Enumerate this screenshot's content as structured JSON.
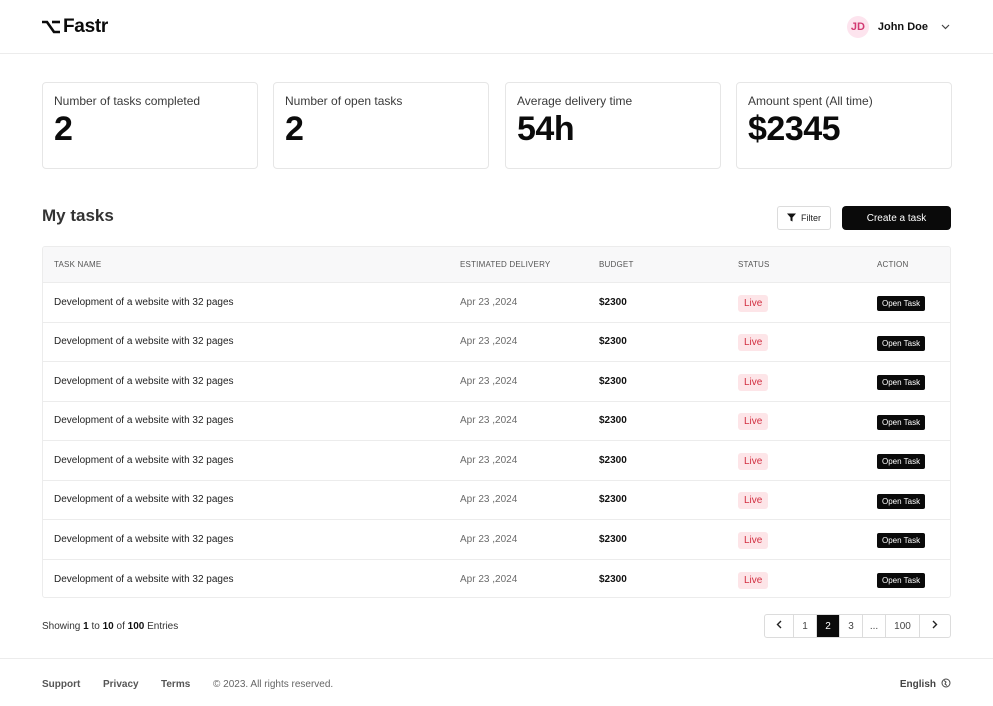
{
  "app": {
    "name": "Fastr"
  },
  "header": {
    "user": {
      "initials": "JD",
      "name": "John Doe"
    }
  },
  "stats": [
    {
      "label": "Number of tasks completed",
      "value": "2"
    },
    {
      "label": "Number of open tasks",
      "value": "2"
    },
    {
      "label": "Average delivery time",
      "value": "54h"
    },
    {
      "label": "Amount spent (All time)",
      "value": "$2345"
    }
  ],
  "tasks": {
    "title": "My tasks",
    "filter_label": "Filter",
    "create_label": "Create a task",
    "columns": [
      "TASK NAME",
      "ESTIMATED DELIVERY",
      "BUDGET",
      "STATUS",
      "ACTION"
    ],
    "rows": [
      {
        "name": "Development of a website with 32 pages",
        "delivery": "Apr 23 ,2024",
        "budget": "$2300",
        "status": "Live",
        "action": "Open Task"
      },
      {
        "name": "Development of a website with 32 pages",
        "delivery": "Apr 23 ,2024",
        "budget": "$2300",
        "status": "Live",
        "action": "Open Task"
      },
      {
        "name": "Development of a website with 32 pages",
        "delivery": "Apr 23 ,2024",
        "budget": "$2300",
        "status": "Live",
        "action": "Open Task"
      },
      {
        "name": "Development of a website with 32 pages",
        "delivery": "Apr 23 ,2024",
        "budget": "$2300",
        "status": "Live",
        "action": "Open Task"
      },
      {
        "name": "Development of a website with 32 pages",
        "delivery": "Apr 23 ,2024",
        "budget": "$2300",
        "status": "Live",
        "action": "Open Task"
      },
      {
        "name": "Development of a website with 32 pages",
        "delivery": "Apr 23 ,2024",
        "budget": "$2300",
        "status": "Live",
        "action": "Open Task"
      },
      {
        "name": "Development of a website with 32 pages",
        "delivery": "Apr 23 ,2024",
        "budget": "$2300",
        "status": "Live",
        "action": "Open Task"
      },
      {
        "name": "Development of a website with 32 pages",
        "delivery": "Apr 23 ,2024",
        "budget": "$2300",
        "status": "Live",
        "action": "Open Task"
      }
    ]
  },
  "pagination": {
    "showing_prefix": "Showing",
    "from": "1",
    "to_word": "to",
    "to": "10",
    "of_word": "of",
    "total": "100",
    "suffix": "Entries",
    "pages": [
      "1",
      "2",
      "3",
      "...",
      "100"
    ],
    "active_page": "2"
  },
  "footer": {
    "links": [
      "Support",
      "Privacy",
      "Terms"
    ],
    "copyright": "© 2023. All rights reserved.",
    "language": "English"
  },
  "colors": {
    "accent": "#0a0a0a",
    "status_live_bg": "#fde5e8",
    "status_live_text": "#d12d3f",
    "avatar_bg": "#fde4ee",
    "avatar_text": "#d23a72"
  },
  "icons": {
    "logo": "option-key-icon",
    "user_menu": "chevron-down-icon",
    "filter": "funnel-icon",
    "prev": "chevron-left-icon",
    "next": "chevron-right-icon",
    "language": "globe-icon"
  }
}
